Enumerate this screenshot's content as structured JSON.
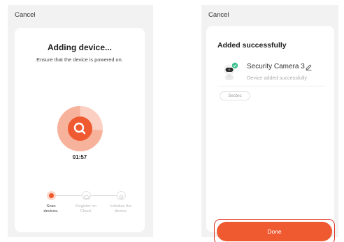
{
  "left_screen": {
    "cancel_label": "Cancel",
    "title": "Adding device...",
    "subtitle": "Ensure that the device is powered on.",
    "timer": "01:57",
    "scan_icon": "search-icon",
    "steps": [
      {
        "label_line1": "Scan",
        "label_line2": "devices.",
        "state": "active"
      },
      {
        "label_line1": "Register on",
        "label_line2": "Cloud.",
        "state": "inactive",
        "icon": "cloud-icon"
      },
      {
        "label_line1": "Initialize the",
        "label_line2": "device.",
        "state": "inactive",
        "icon": "check-icon"
      }
    ]
  },
  "right_screen": {
    "cancel_label": "Cancel",
    "title": "Added successfully",
    "device": {
      "name": "Security Camera 3",
      "status": "Device added successfully",
      "icon": "camera-icon",
      "badge_icon": "check-icon",
      "edit_icon": "pencil-icon"
    },
    "room_chip": "Sectec",
    "done_label": "Done"
  },
  "colors": {
    "accent": "#ef5a31",
    "accent_light": "#fbd7c9",
    "success": "#3ec28f",
    "highlight_outline": "#e03a2a"
  }
}
